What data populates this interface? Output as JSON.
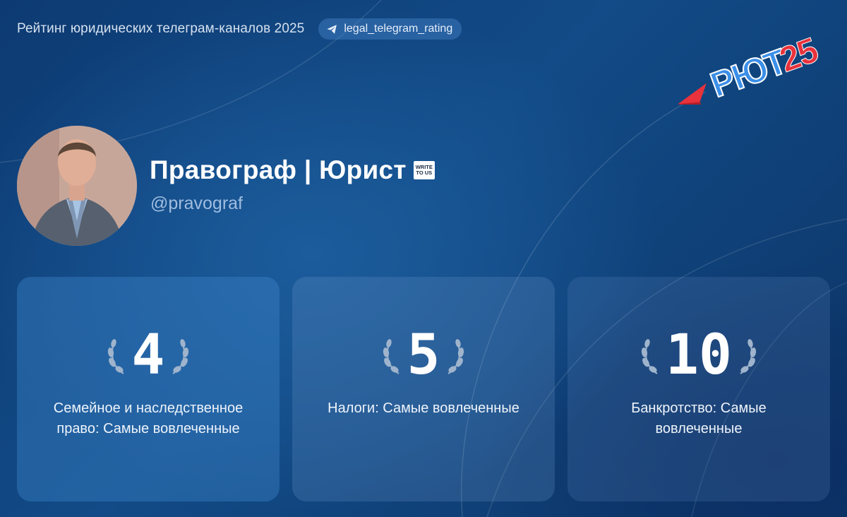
{
  "header": {
    "title": "Рейтинг юридических телеграм-каналов 2025",
    "tag_label": "legal_telegram_rating",
    "tag_icon": "telegram-plane-icon"
  },
  "logo": {
    "text_main": "РЮТ",
    "text_year": "25",
    "colors": {
      "main": "#3b8fe8",
      "accent": "#e8323c"
    }
  },
  "channel": {
    "name": "Правограф | Юрист",
    "badge_line1": "WRITE",
    "badge_line2": "TO US",
    "handle": "@pravograf"
  },
  "cards": [
    {
      "rank": "4",
      "label": "Семейное и наследственное право: Самые вовлеченные"
    },
    {
      "rank": "5",
      "label": "Налоги: Самые вовлеченные"
    },
    {
      "rank": "10",
      "label": "Банкротство: Самые вовлеченные"
    }
  ],
  "colors": {
    "background": "#124b87",
    "text_secondary": "#9fbde0",
    "tag_bg": "#3f7fc4"
  }
}
